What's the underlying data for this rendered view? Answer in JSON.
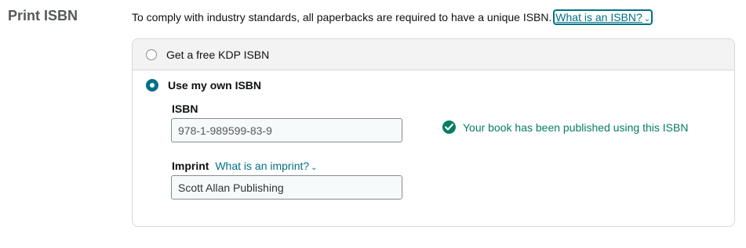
{
  "section": {
    "title": "Print ISBN",
    "intro_text": "To comply with industry standards, all paperbacks are required to have a unique ISBN.",
    "intro_link": "What is an ISBN?"
  },
  "options": {
    "free_label": "Get a free KDP ISBN",
    "own_label": "Use my own ISBN",
    "selected": "own"
  },
  "isbn": {
    "label": "ISBN",
    "value": "978-1-989599-83-9",
    "status": "Your book has been published using this ISBN"
  },
  "imprint": {
    "label": "Imprint",
    "help_link": "What is an imprint?",
    "value": "Scott Allan Publishing"
  },
  "colors": {
    "link": "#007185",
    "success": "#067d62",
    "radio_selected": "#007185"
  },
  "icons": {
    "status": "check-circle-icon",
    "link_chevron": "chevron-down-icon"
  }
}
